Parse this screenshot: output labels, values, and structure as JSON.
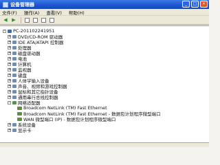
{
  "window": {
    "title": "设备管理器"
  },
  "menu": [
    "文件(F)",
    "操作(A)",
    "查看(V)",
    "帮助(H)"
  ],
  "toolbar": [
    "back-icon",
    "forward-icon",
    "view-icon",
    "properties-icon",
    "help-icon",
    "refresh-icon"
  ],
  "tree": {
    "root": "PC-201102241951",
    "items": [
      {
        "label": "DVD/CD-ROM 驱动器",
        "icon": "dvd-icon"
      },
      {
        "label": "IDE ATA/ATAPI 控制器",
        "icon": "ide-icon"
      },
      {
        "label": "处理器",
        "icon": "cpu-icon"
      },
      {
        "label": "磁盘驱动器",
        "icon": "disk-icon"
      },
      {
        "label": "电池",
        "icon": "battery-icon"
      },
      {
        "label": "计算机",
        "icon": "computer-icon"
      },
      {
        "label": "监视器",
        "icon": "monitor-icon"
      },
      {
        "label": "键盘",
        "icon": "keyboard-icon"
      },
      {
        "label": "人体学输入设备",
        "icon": "hid-icon"
      },
      {
        "label": "声音、视频和游戏控制器",
        "icon": "sound-icon"
      },
      {
        "label": "鼠标和其它指针设备",
        "icon": "mouse-icon"
      },
      {
        "label": "通用串行总线控制器",
        "icon": "usb-icon"
      },
      {
        "label": "网络适配器",
        "icon": "network-icon",
        "expanded": true,
        "children": [
          {
            "label": "Broadcom NetLink (TM) Fast Ethernet",
            "icon": "adapter-icon"
          },
          {
            "label": "Broadcom NetLink (TM) Fast Ethernet - 数据包计划程序微型端口",
            "icon": "adapter-icon"
          },
          {
            "label": "WAN 微型端口 (IP) - 数据包计划程序微型端口",
            "icon": "adapter-icon"
          }
        ]
      },
      {
        "label": "系统设备",
        "icon": "system-icon"
      },
      {
        "label": "显示卡",
        "icon": "display-icon"
      }
    ]
  }
}
